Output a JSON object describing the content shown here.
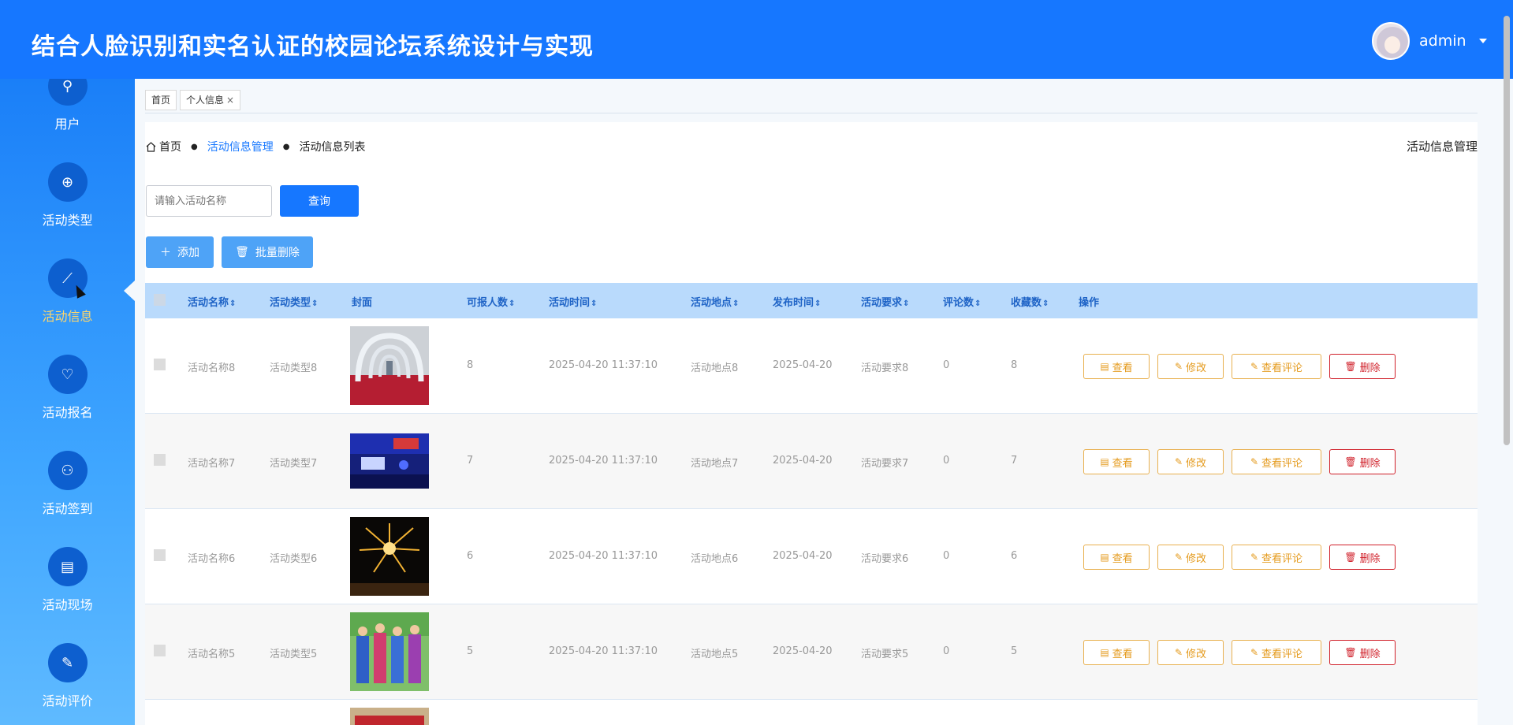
{
  "header": {
    "title": "结合人脸识别和实名认证的校园论坛系统设计与实现",
    "username": "admin"
  },
  "sidebar": {
    "items": [
      {
        "label": "用户",
        "icon": "search-icon",
        "glyph": "⚲"
      },
      {
        "label": "活动类型",
        "icon": "add-circle-icon",
        "glyph": "⊕"
      },
      {
        "label": "活动信息",
        "icon": "line-chart-icon",
        "glyph": "⟋"
      },
      {
        "label": "活动报名",
        "icon": "heart-icon",
        "glyph": "♡"
      },
      {
        "label": "活动签到",
        "icon": "user-check-icon",
        "glyph": "⚇"
      },
      {
        "label": "活动现场",
        "icon": "calendar-icon",
        "glyph": "▤"
      },
      {
        "label": "活动评价",
        "icon": "comment-icon",
        "glyph": "✎"
      }
    ],
    "active_index": 2
  },
  "tabs": [
    {
      "label": "首页"
    },
    {
      "label": "个人信息",
      "close": "×"
    }
  ],
  "breadcrumb": {
    "home": "首页",
    "level1": "活动信息管理",
    "level2": "活动信息列表",
    "sep": "●"
  },
  "page_title_right": "活动信息管理",
  "search": {
    "placeholder": "请输入活动名称",
    "button": "查询"
  },
  "toolbar": {
    "add": "添加",
    "batch_delete": "批量删除"
  },
  "table": {
    "headers": {
      "name": "活动名称",
      "type": "活动类型",
      "cover": "封面",
      "capacity": "可报人数",
      "time": "活动时间",
      "place": "活动地点",
      "publish": "发布时间",
      "requirement": "活动要求",
      "comments": "评论数",
      "favorites": "收藏数",
      "ops": "操作"
    },
    "sort_glyph": "⇕",
    "rows": [
      {
        "name": "活动名称8",
        "type": "活动类型8",
        "capacity": "8",
        "time": "2025-04-20 11:37:10",
        "place": "活动地点8",
        "publish": "2025-04-20",
        "requirement": "活动要求8",
        "comments": "0",
        "favorites": "8"
      },
      {
        "name": "活动名称7",
        "type": "活动类型7",
        "capacity": "7",
        "time": "2025-04-20 11:37:10",
        "place": "活动地点7",
        "publish": "2025-04-20",
        "requirement": "活动要求7",
        "comments": "0",
        "favorites": "7"
      },
      {
        "name": "活动名称6",
        "type": "活动类型6",
        "capacity": "6",
        "time": "2025-04-20 11:37:10",
        "place": "活动地点6",
        "publish": "2025-04-20",
        "requirement": "活动要求6",
        "comments": "0",
        "favorites": "6"
      },
      {
        "name": "活动名称5",
        "type": "活动类型5",
        "capacity": "5",
        "time": "2025-04-20 11:37:10",
        "place": "活动地点5",
        "publish": "2025-04-20",
        "requirement": "活动要求5",
        "comments": "0",
        "favorites": "5"
      }
    ],
    "actions": {
      "view": "查看",
      "edit": "修改",
      "view_comments": "查看评论",
      "delete": "删除"
    }
  },
  "colors": {
    "primary": "#1677ff",
    "warning": "#e49a1c",
    "danger": "#d0202a",
    "active_nav": "#ffd76b"
  }
}
